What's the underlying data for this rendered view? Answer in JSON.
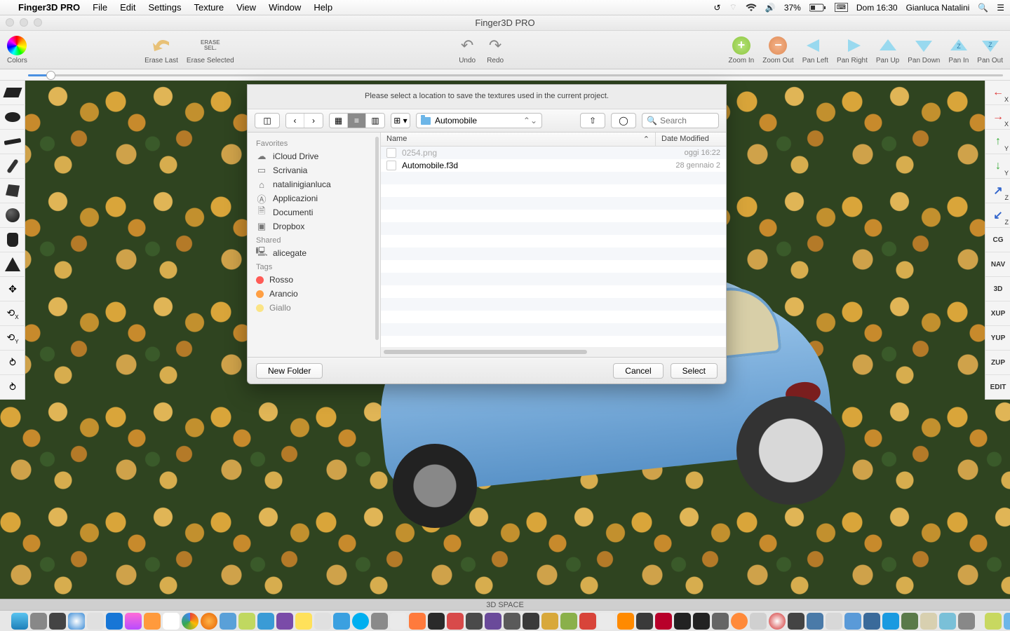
{
  "menubar": {
    "app": "Finger3D PRO",
    "items": [
      "File",
      "Edit",
      "Settings",
      "Texture",
      "View",
      "Window",
      "Help"
    ],
    "battery": "37%",
    "datetime": "Dom 16:30",
    "user": "Gianluca Natalini"
  },
  "window": {
    "title": "Finger3D PRO"
  },
  "toolbar": {
    "colors": "Colors",
    "erase_last": "Erase Last",
    "erase_sel": "Erase Selected",
    "erase_sel_icon": "ERASE\nSEL.",
    "undo": "Undo",
    "redo": "Redo",
    "zoom_in": "Zoom In",
    "zoom_out": "Zoom Out",
    "pan_left": "Pan Left",
    "pan_right": "Pan Right",
    "pan_up": "Pan Up",
    "pan_down": "Pan Down",
    "pan_in": "Pan In",
    "pan_out": "Pan Out"
  },
  "viewport": {
    "label": "3D SPACE"
  },
  "right_tools": {
    "cg": "CG",
    "nav": "NAV",
    "three_d": "3D",
    "xup": "XUP",
    "yup": "YUP",
    "zup": "ZUP",
    "edit": "EDIT",
    "x": "X",
    "y": "Y",
    "z": "Z"
  },
  "sheet": {
    "message": "Please select a location to save the textures used in the current project.",
    "path": "Automobile",
    "search_placeholder": "Search",
    "sidebar": {
      "favorites_head": "Favorites",
      "favorites": [
        "iCloud Drive",
        "Scrivania",
        "natalinigianluca",
        "Applicazioni",
        "Documenti",
        "Dropbox"
      ],
      "shared_head": "Shared",
      "shared": [
        "alicegate"
      ],
      "tags_head": "Tags",
      "tags": [
        {
          "label": "Rosso",
          "color": "#ff5b56"
        },
        {
          "label": "Arancio",
          "color": "#ff9f43"
        },
        {
          "label": "Giallo",
          "color": "#ffd93b"
        }
      ]
    },
    "columns": {
      "name": "Name",
      "date": "Date Modified"
    },
    "files": [
      {
        "name": "0254.png",
        "date": "oggi 16:22",
        "dim": true
      },
      {
        "name": "Automobile.f3d",
        "date": "28 gennaio 2",
        "dim": false
      }
    ],
    "new_folder": "New Folder",
    "cancel": "Cancel",
    "select": "Select"
  }
}
